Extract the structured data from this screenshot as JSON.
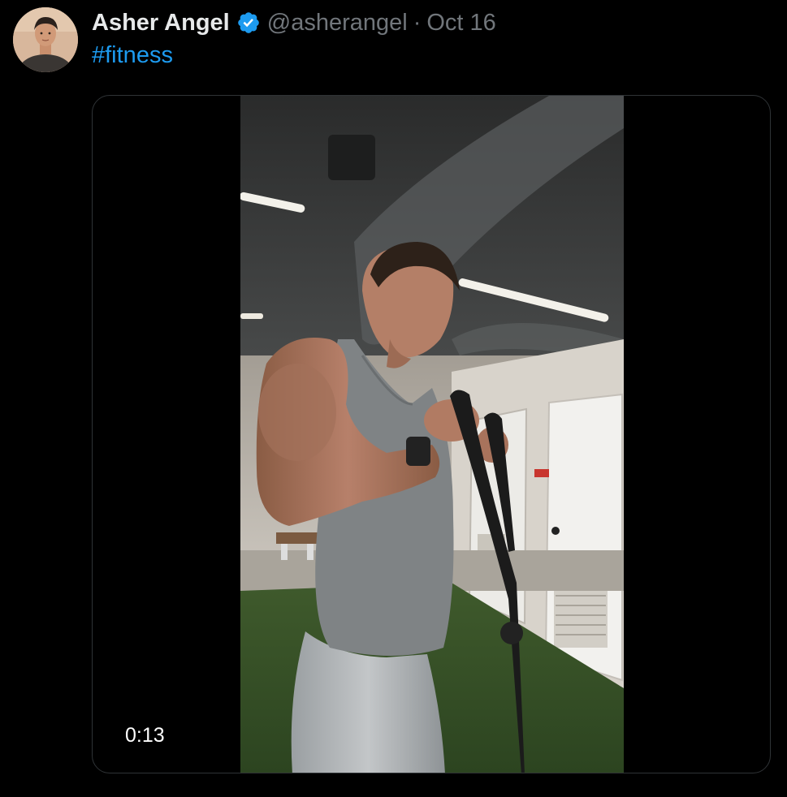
{
  "tweet": {
    "display_name": "Asher Angel",
    "handle": "@asherangel",
    "separator": "·",
    "date": "Oct 16",
    "text": "#fitness"
  },
  "media": {
    "type": "video",
    "duration": "0:13"
  },
  "colors": {
    "background": "#000000",
    "name": "#e7e9ea",
    "muted": "#71767b",
    "accent": "#1d9bf0",
    "verified": "#1d9bf0"
  },
  "icons": {
    "verified": "verified-badge-icon",
    "avatar": "profile-avatar"
  }
}
